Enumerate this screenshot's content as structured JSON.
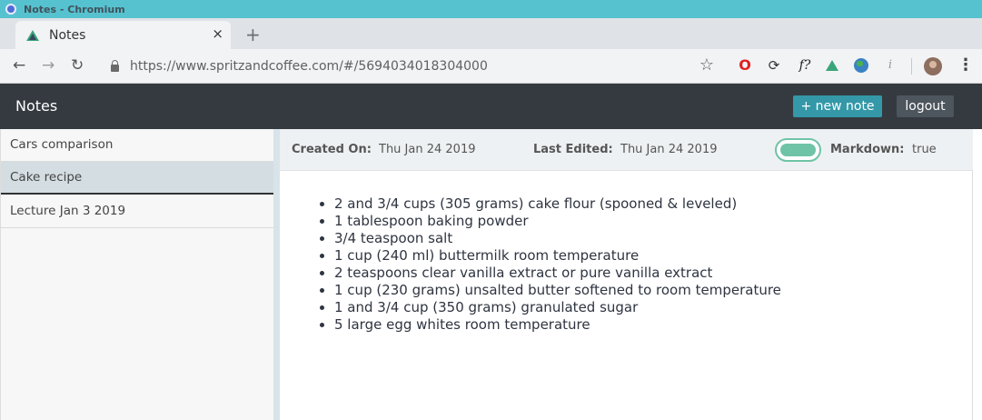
{
  "window": {
    "title": "Notes - Chromium"
  },
  "browser": {
    "tab_label": "Notes",
    "tab_close": "×",
    "new_tab": "+",
    "url": "https://www.spritzandcoffee.com/#/5694034018304000",
    "back": "←",
    "forward": "→",
    "reload": "↻",
    "star": "☆",
    "menu": "⋮",
    "extensions": {
      "opera": "O",
      "sync": "⟳",
      "f": "f?",
      "info": "i"
    }
  },
  "app": {
    "title": "Notes",
    "new_note_label": "+ new note",
    "logout_label": "logout"
  },
  "sidebar": {
    "notes": [
      {
        "title": "Cars comparison"
      },
      {
        "title": "Cake recipe"
      },
      {
        "title": "Lecture  Jan 3 2019"
      }
    ]
  },
  "note": {
    "created_label": "Created On:",
    "created_value": "Thu Jan 24 2019",
    "edited_label": "Last Edited:",
    "edited_value": "Thu Jan 24 2019",
    "markdown_label": "Markdown:",
    "markdown_value": "true",
    "items": [
      "2 and 3/4 cups (305 grams) cake flour (spooned & leveled)",
      "1 tablespoon baking powder",
      "3/4 teaspoon salt",
      "1 cup (240 ml) buttermilk room temperature",
      "2 teaspoons clear vanilla extract or pure vanilla extract",
      "1 cup (230 grams) unsalted butter softened to room temperature",
      "1 and 3/4 cup (350 grams) granulated sugar",
      "5 large egg whites room temperature"
    ]
  }
}
